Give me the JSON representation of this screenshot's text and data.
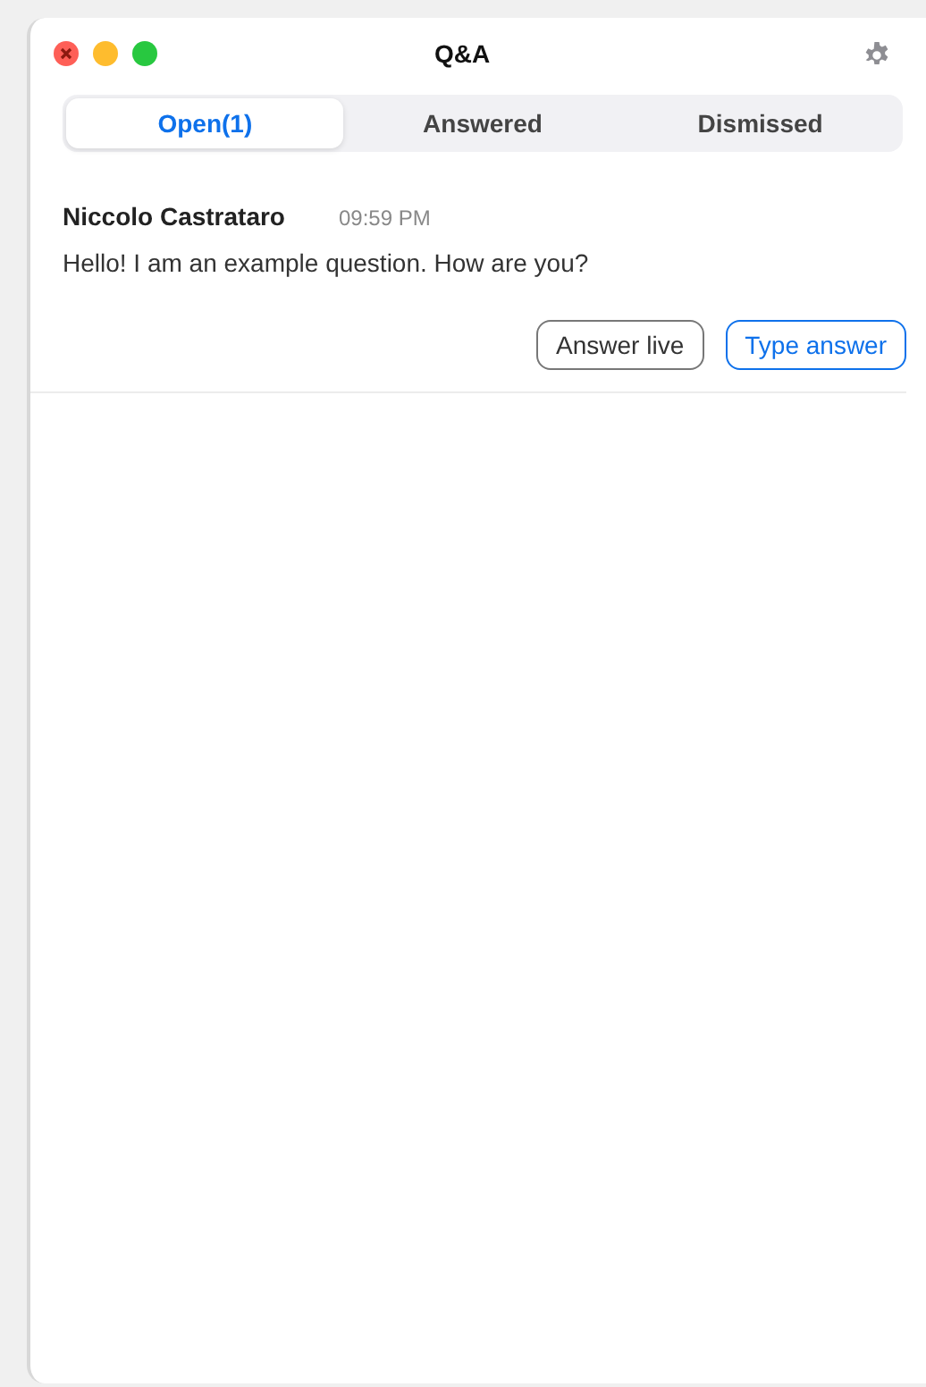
{
  "window": {
    "title": "Q&A"
  },
  "tabs": [
    {
      "label": "Open(1)",
      "selected": true
    },
    {
      "label": "Answered",
      "selected": false
    },
    {
      "label": "Dismissed",
      "selected": false
    }
  ],
  "questions": [
    {
      "author": "Niccolo Castrataro",
      "time": "09:59 PM",
      "text": "Hello! I am an example question. How are you?",
      "buttons": [
        {
          "label": "Answer live",
          "kind": "plain"
        },
        {
          "label": "Type answer",
          "kind": "accent"
        }
      ]
    }
  ]
}
